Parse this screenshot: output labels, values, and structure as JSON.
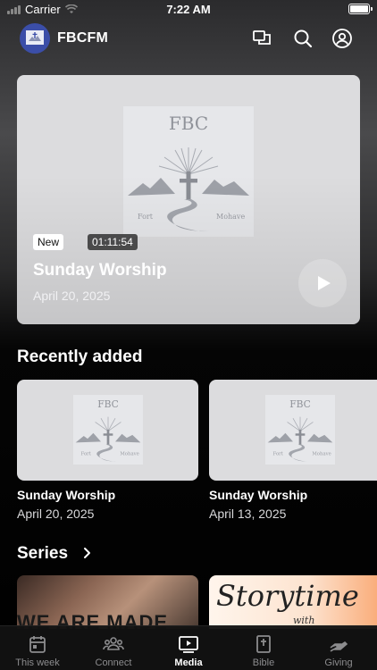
{
  "status_bar": {
    "carrier": "Carrier",
    "time": "7:22 AM"
  },
  "header": {
    "app_name": "FBCFM"
  },
  "hero": {
    "badge": "New",
    "duration": "01:11:54",
    "title": "Sunday Worship",
    "date": "April 20, 2025",
    "artwork": {
      "top_text": "FBC",
      "left_text": "Fort",
      "right_text": "Mohave"
    }
  },
  "recently_added": {
    "title": "Recently added",
    "items": [
      {
        "title": "Sunday Worship",
        "date": "April 20, 2025"
      },
      {
        "title": "Sunday Worship",
        "date": "April 13, 2025"
      }
    ]
  },
  "series": {
    "title": "Series",
    "items": [
      {
        "title": "WE ARE MADE"
      },
      {
        "title": "Storytime",
        "subtitle": "with"
      }
    ]
  },
  "tabbar": {
    "active": "Media",
    "tabs": [
      {
        "label": "This week",
        "icon": "calendar-icon"
      },
      {
        "label": "Connect",
        "icon": "people-icon"
      },
      {
        "label": "Media",
        "icon": "play-screen-icon"
      },
      {
        "label": "Bible",
        "icon": "bible-icon"
      },
      {
        "label": "Giving",
        "icon": "giving-hand-icon"
      }
    ]
  },
  "colors": {
    "card_bg": "#dcdcde",
    "accent_white": "#ffffff",
    "tab_inactive": "#8c8c8e"
  }
}
